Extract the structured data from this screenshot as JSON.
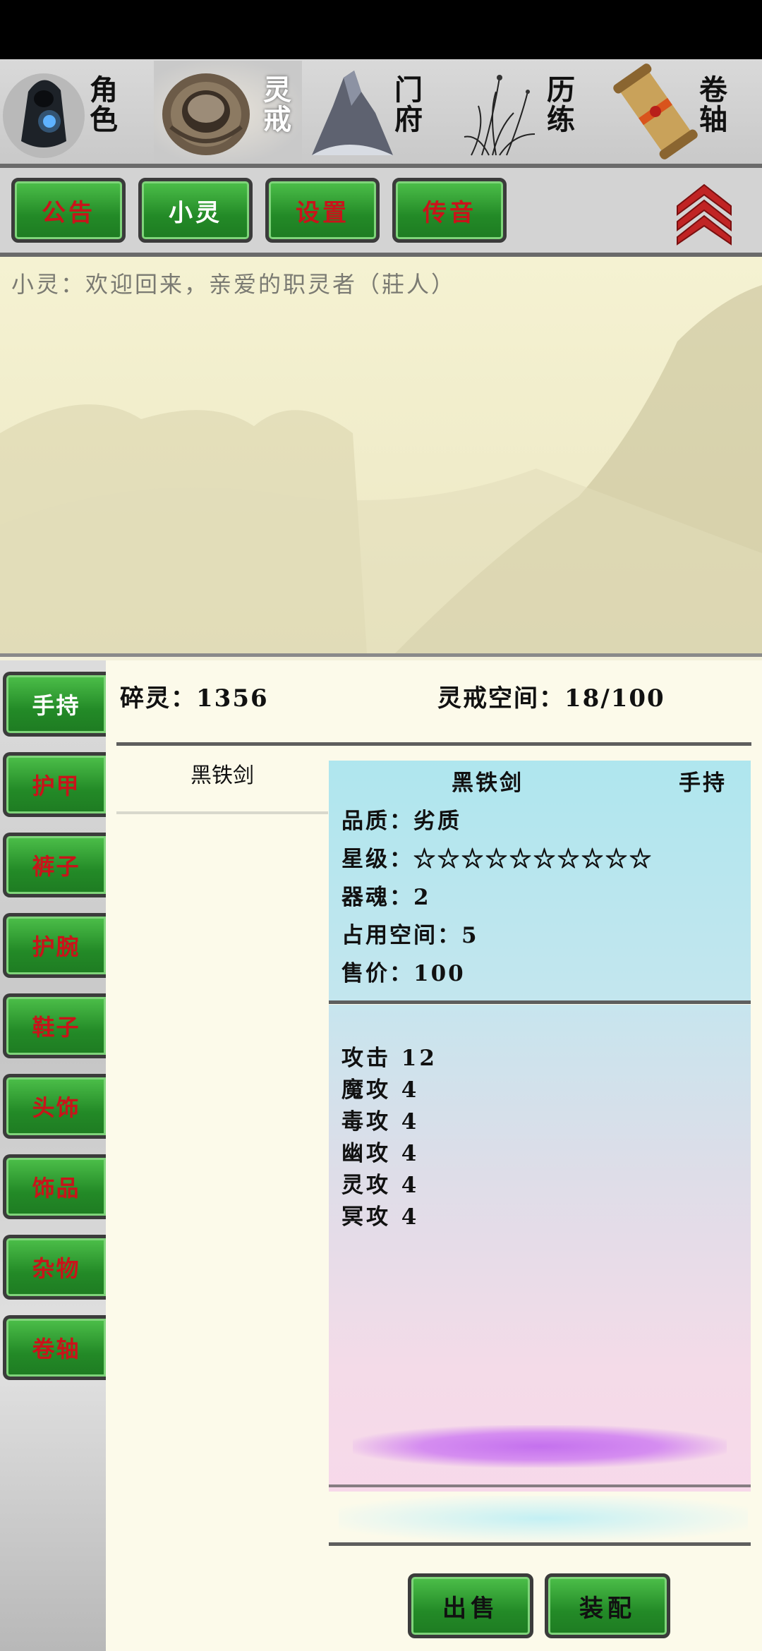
{
  "nav": {
    "items": [
      {
        "label": "角色",
        "icon": "hooded-figure-icon"
      },
      {
        "label": "灵戒",
        "icon": "ring-icon"
      },
      {
        "label": "门府",
        "icon": "mountain-icon"
      },
      {
        "label": "历练",
        "icon": "grass-icon"
      },
      {
        "label": "卷轴",
        "icon": "scroll-icon"
      }
    ],
    "active": "灵戒"
  },
  "toolbar": {
    "buttons": [
      "公告",
      "小灵",
      "设置",
      "传音"
    ],
    "active": "小灵"
  },
  "message": {
    "text": "小灵：欢迎回来，亲爱的职灵者（莊人）"
  },
  "side_menu": {
    "items": [
      "手持",
      "护甲",
      "裤子",
      "护腕",
      "鞋子",
      "头饰",
      "饰品",
      "杂物",
      "卷轴"
    ],
    "active": "手持"
  },
  "stats": {
    "fragments": "碎灵：1356",
    "ring_space": "灵戒空间：18/100"
  },
  "inventory": {
    "items": [
      "黑铁剑"
    ]
  },
  "detail": {
    "name": "黑铁剑",
    "slot": "手持",
    "quality": "品质：劣质",
    "stars": "星级：☆☆☆☆☆☆☆☆☆☆",
    "soul": "器魂：2",
    "space": "占用空间：5",
    "price": "售价：100",
    "attributes": [
      "攻击 12",
      "魔攻 4",
      "毒攻 4",
      "幽攻 4",
      "灵攻 4",
      "冥攻 4"
    ]
  },
  "actions": {
    "sell": "出售",
    "equip": "装配"
  },
  "colors": {
    "button_green": "#2e9e2f",
    "button_text_red": "#c8141a",
    "detail_cyan": "#afe6ee",
    "detail_pink": "#f7d9ea"
  }
}
